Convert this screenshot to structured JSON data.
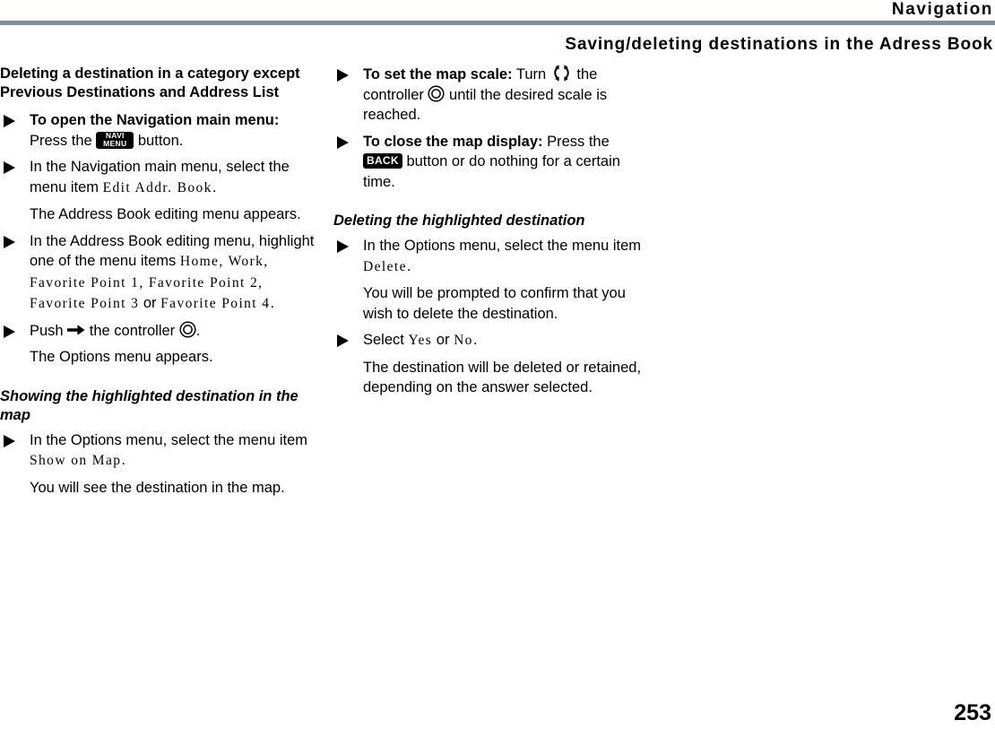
{
  "header": {
    "chapter": "Navigation",
    "subtitle": "Saving/deleting destinations in the Adress Book",
    "rule_color": "#7f8e91"
  },
  "footer": {
    "page_number": "253"
  },
  "icons": {
    "navi_menu_line1": "NAVI",
    "navi_menu_line2": "MENU",
    "back_label": "BACK",
    "controller": "controller-dial-icon",
    "turn": "turn-rotate-icon",
    "push_arrow": "arrow-right-icon",
    "bullet": "triangle-right-bullet"
  },
  "left_column": {
    "section_title": "Deleting a destination in a category except Previous Destinations and Address List",
    "steps": [
      {
        "bold_lead": "To open the Navigation main menu:",
        "text_before_icon": " Press the ",
        "icon": "navi-menu-key",
        "text_after_icon": " button."
      },
      {
        "text_before_item": "In the Navigation main menu, select the menu item ",
        "menu_item": "Edit Addr. Book",
        "text_after_item": "."
      }
    ],
    "note_1": "The Address Book editing menu appears.",
    "step_highlight": {
      "text_before": "In the Address Book editing menu, highlight one of the menu items ",
      "items": "Home, Work, Favorite Point 1, Favorite Point 2, Favorite Point 3",
      "conjunction": " or ",
      "last_item": "Favorite Point 4",
      "text_after": "."
    },
    "step_push": {
      "text_before_arrow": "Push ",
      "text_between": " the controller ",
      "text_after": "."
    },
    "note_2": "The Options menu appears.",
    "subsection_title": "Showing the highlighted destination in the map",
    "step_show": {
      "text_before_item": "In the Options menu, select the menu item ",
      "menu_item": "Show on Map",
      "text_after_item": "."
    },
    "note_3": "You will see the destination in the map."
  },
  "right_column": {
    "step_scale": {
      "bold_lead": "To set the map scale:",
      "text_before_turn": " Turn ",
      "text_before_controller": " the controller ",
      "text_after": " until the desired scale is reached."
    },
    "step_close": {
      "bold_lead": "To close the map display:",
      "text_before_key": " Press the ",
      "text_after_key": " button or do nothing for a certain time."
    },
    "subsection_title": "Deleting the highlighted destination",
    "step_delete": {
      "text_before_item": "In the Options menu, select the menu item ",
      "menu_item": "Delete",
      "text_after_item": "."
    },
    "note_1": "You will be prompted to confirm that you wish to delete the destination.",
    "step_select": {
      "text_before": "Select ",
      "option_yes": "Yes",
      "conjunction": " or ",
      "option_no": "No",
      "text_after": "."
    },
    "note_2": "The destination will be deleted or retained, depending on the answer selected."
  }
}
